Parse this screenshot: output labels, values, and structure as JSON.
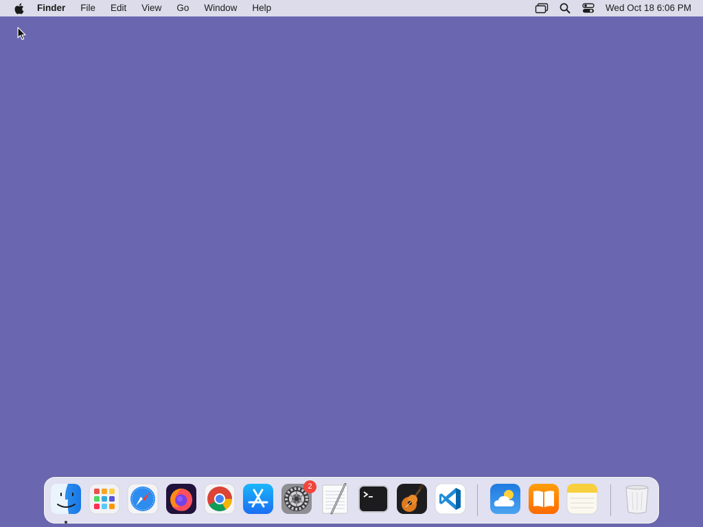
{
  "menubar": {
    "app_name": "Finder",
    "items": [
      "File",
      "Edit",
      "View",
      "Go",
      "Window",
      "Help"
    ],
    "clock": "Wed Oct 18  6:06 PM",
    "status_icons": [
      "screen-mirroring-icon",
      "spotlight-search-icon",
      "control-center-icon"
    ]
  },
  "desktop": {
    "background_color": "#6b66b0"
  },
  "dock": {
    "apps": [
      {
        "name": "Finder",
        "icon": "finder-icon",
        "running": true
      },
      {
        "name": "Launchpad",
        "icon": "launchpad-icon"
      },
      {
        "name": "Safari",
        "icon": "safari-icon"
      },
      {
        "name": "Firefox",
        "icon": "firefox-icon"
      },
      {
        "name": "Google Chrome",
        "icon": "chrome-icon"
      },
      {
        "name": "App Store",
        "icon": "app-store-icon"
      },
      {
        "name": "System Settings",
        "icon": "system-settings-icon",
        "badge": "2"
      },
      {
        "name": "TextEdit",
        "icon": "textedit-icon"
      },
      {
        "name": "Terminal",
        "icon": "terminal-icon"
      },
      {
        "name": "GarageBand",
        "icon": "garageband-icon"
      },
      {
        "name": "Visual Studio Code",
        "icon": "vscode-icon"
      },
      {
        "name": "Weather",
        "icon": "weather-icon"
      },
      {
        "name": "Books",
        "icon": "books-icon"
      },
      {
        "name": "Notes",
        "icon": "notes-icon"
      },
      {
        "name": "Trash",
        "icon": "trash-icon"
      }
    ]
  }
}
